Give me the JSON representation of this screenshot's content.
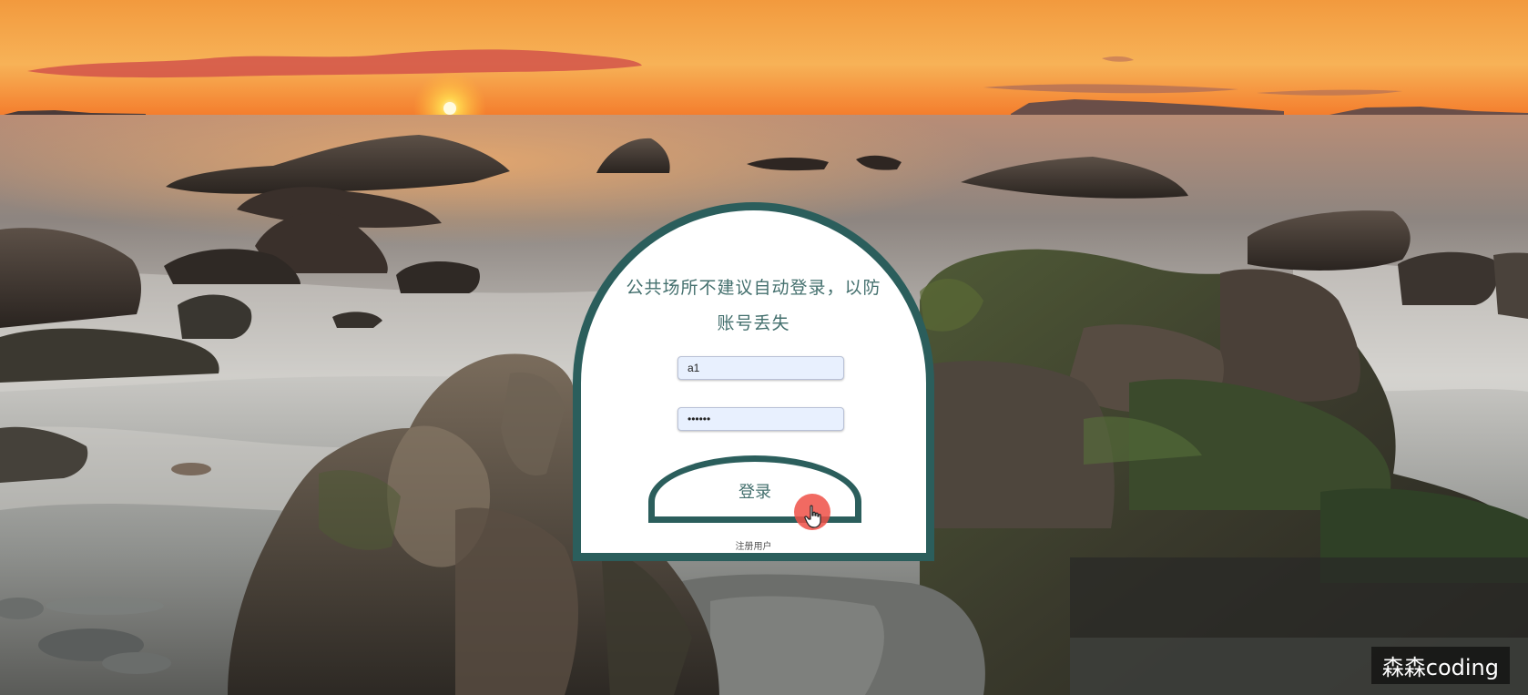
{
  "login": {
    "notice": "公共场所不建议自动登录，以防账号丢失",
    "username_value": "a1",
    "password_value": "••••••",
    "login_label": "登录",
    "register_label": "注册用户"
  },
  "watermark": "森森coding",
  "colors": {
    "accent": "#2b5e5c",
    "text": "#44706e",
    "input_bg": "#e8f0fe",
    "cursor_highlight": "#ee5046"
  },
  "icons": {
    "cursor": "hand-pointer-icon"
  }
}
